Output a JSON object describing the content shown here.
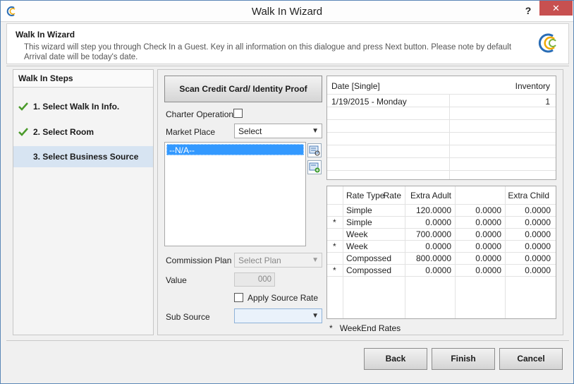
{
  "window": {
    "title": "Walk In Wizard",
    "help": "?",
    "close": "✕"
  },
  "header": {
    "title": "Walk In Wizard",
    "description": "This wizard will step you through Check In a Guest. Key in all information on this dialogue and press Next button. Please note by default Arrival date will be today's date."
  },
  "steps": {
    "title": "Walk In Steps",
    "items": [
      {
        "label": "1.  Select Walk In Info.",
        "done": true
      },
      {
        "label": "2.  Select Room",
        "done": true
      },
      {
        "label": "3.  Select Business Source",
        "done": false
      }
    ]
  },
  "form": {
    "scan_label": "Scan Credit Card/ Identity Proof",
    "charter_label": "Charter Operation",
    "market_label": "Market Place",
    "market_value": "Select",
    "list_selected": "--N/A--",
    "commission_label": "Commission Plan",
    "commission_value": "Select Plan",
    "value_label": "Value",
    "value_value": "000",
    "apply_label": "Apply Source Rate",
    "subsource_label": "Sub Source",
    "subsource_value": ""
  },
  "dates_grid": {
    "headers": [
      "Date [Single]",
      "Inventory"
    ],
    "rows": [
      [
        "1/19/2015 - Monday",
        "1"
      ]
    ]
  },
  "rates_grid": {
    "headers": [
      "Rate Type",
      "Rate",
      "Extra Adult",
      "Extra Child"
    ],
    "rows": [
      {
        "mark": "",
        "type": "Simple",
        "rate": "120.0000",
        "adult": "0.0000",
        "child": "0.0000"
      },
      {
        "mark": "*",
        "type": "Simple",
        "rate": "0.0000",
        "adult": "0.0000",
        "child": "0.0000"
      },
      {
        "mark": "",
        "type": "Week",
        "rate": "700.0000",
        "adult": "0.0000",
        "child": "0.0000"
      },
      {
        "mark": "*",
        "type": "Week",
        "rate": "0.0000",
        "adult": "0.0000",
        "child": "0.0000"
      },
      {
        "mark": "",
        "type": "Compossed",
        "rate": "800.0000",
        "adult": "0.0000",
        "child": "0.0000"
      },
      {
        "mark": "*",
        "type": "Compossed",
        "rate": "0.0000",
        "adult": "0.0000",
        "child": "0.0000"
      }
    ]
  },
  "footnote": {
    "mark": "*",
    "text": "WeekEnd Rates"
  },
  "buttons": {
    "back": "Back",
    "finish": "Finish",
    "cancel": "Cancel"
  },
  "colors": {
    "accent": "#3399ff",
    "active_step": "#d7e4f2",
    "close": "#c75050",
    "check": "#4a9a2a"
  }
}
